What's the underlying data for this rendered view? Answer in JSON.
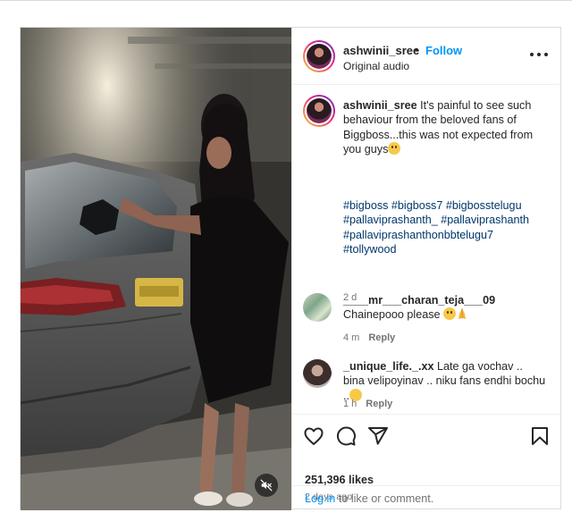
{
  "post": {
    "author": {
      "username": "ashwinii_sree",
      "follow_label": "Follow",
      "separator": "•",
      "audio": "Original audio"
    },
    "caption": {
      "username": "ashwinii_sree",
      "text": "It's painful to see such behaviour from the beloved fans of Biggboss...this was not expected from you guys",
      "emoji": "sad-face-emoji",
      "hashtags": [
        "#bigboss",
        "#bigboss7",
        "#bigbosstelugu",
        "#pallaviprashanth_",
        "#pallaviprashanth",
        "#pallaviprashanthonbbtelugu7",
        "#tollywood"
      ],
      "time": "2 d"
    },
    "comments": [
      {
        "username": "____mr___charan_teja___09",
        "text": "Chainepooo please",
        "emojis": [
          "sad-face-emoji",
          "folded-hands-emoji"
        ],
        "time": "4 m",
        "reply_label": "Reply"
      },
      {
        "username": "_unique_life._.xx",
        "text": "Late ga vochav .. bina velipoyinav .. niku fans endhi bochu ..",
        "emojis": [
          "laughing-crying-emoji"
        ],
        "time": "1 h",
        "reply_label": "Reply"
      }
    ],
    "likes": "251,396 likes",
    "posted_ago": "2 days ago",
    "footer": {
      "login_label": "Log in",
      "rest_text": "to like or comment."
    },
    "colors": {
      "link_blue": "#0095f6",
      "hashtag_blue": "#00376b",
      "muted_gray": "#737373",
      "text": "#262626"
    },
    "icons": [
      "more-options-icon",
      "heart-icon",
      "comment-icon",
      "share-icon",
      "save-bookmark-icon",
      "audio-muted-icon"
    ]
  }
}
